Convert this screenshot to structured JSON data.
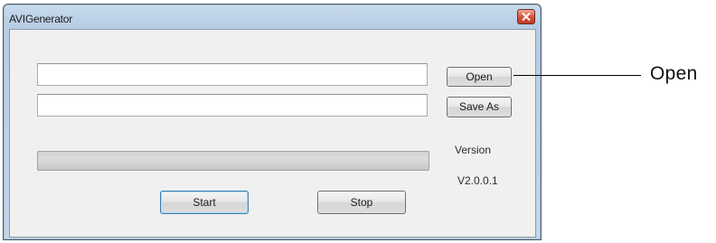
{
  "window": {
    "title": "AVIGenerator",
    "close_icon": "close-icon"
  },
  "form": {
    "input_path_value": "",
    "output_path_value": "",
    "open_label": "Open",
    "save_as_label": "Save As",
    "progress": 0,
    "version_label": "Version",
    "version_value": "V2.0.0.1",
    "start_label": "Start",
    "stop_label": "Stop"
  },
  "annotation": {
    "callout_label": "Open"
  }
}
